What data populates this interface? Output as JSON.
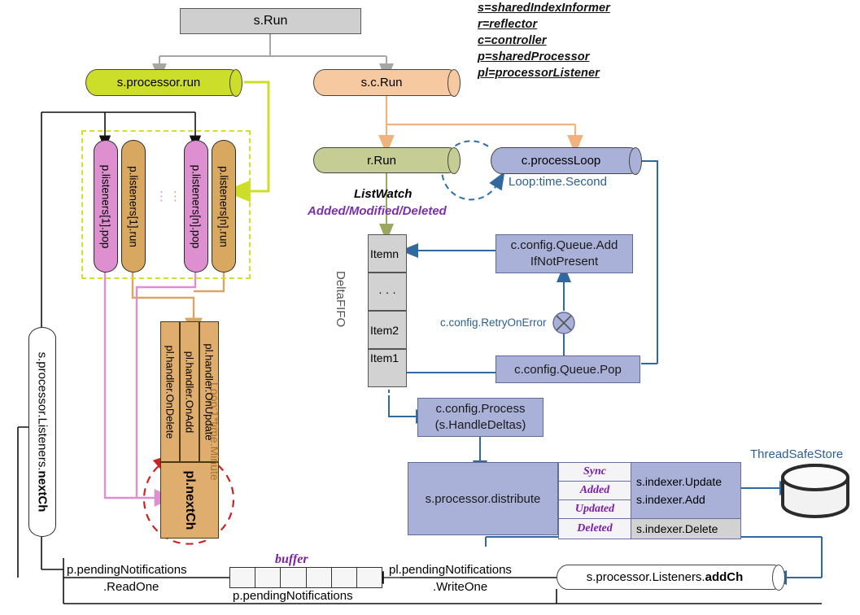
{
  "legend": [
    "s=sharedIndexInformer",
    "r=reflector",
    "c=controller",
    "p=sharedProcessor",
    "pl=processorListener"
  ],
  "nodes": {
    "s_run": "s.Run",
    "s_processor_run": "s.processor.run",
    "s_c_run": "s.c.Run",
    "r_run": "r.Run",
    "c_process_loop": "c.processLoop",
    "loop_second": "Loop:time.Second",
    "listwatch": "ListWatch",
    "added_modified_deleted": "Added/Modified/Deleted",
    "listener_pop_1": "p.listeners[1].pop",
    "listener_run_1": "p.listeners[1].run",
    "listener_pop_n": "p.listeners[n].pop",
    "listener_run_n": "p.listeners[n].run",
    "ellipsis": "⋮",
    "handler_on_update": "pl.handler.OnUpdate",
    "handler_on_add": "pl.handler.OnAdd",
    "handler_on_delete": "pl.handler.OnDelete",
    "pl_next_ch": "pl.nextCh",
    "loop_minute": "Loop:1*time.Minute",
    "processor_listeners_nextch_prefix": "s.processor.Listeners.",
    "processor_listeners_nextch_bold": "nextCh",
    "deltafifo": "DeltaFIFO",
    "fifo_item_n": "Itemn",
    "fifo_dots": "· · ·",
    "fifo_item_2": "Item2",
    "fifo_item_1": "Item1",
    "queue_add_if_not_present": "c.config.Queue.Add\nIfNotPresent",
    "queue_add_line1": "c.config.Queue.Add",
    "queue_add_line2": "IfNotPresent",
    "retry_on_error": "c.config.RetryOnError",
    "queue_pop": "c.config.Queue.Pop",
    "config_process_line1": "c.config.Process",
    "config_process_line2": "(s.HandleDeltas)",
    "processor_distribute": "s.processor.distribute",
    "thread_safe_store": "ThreadSafeStore",
    "buffer_label": "buffer",
    "buffer_name": "p.pendingNotifications",
    "pending_read_line1": "p.pendingNotifications",
    "pending_read_line2": ".ReadOne",
    "pending_write_line1": "pl.pendingNotifications",
    "pending_write_line2": ".WriteOne",
    "listeners_addch_prefix": "s.processor.Listeners.",
    "listeners_addch_bold": "addCh"
  },
  "distribute_table": {
    "events": [
      "Sync",
      "Added",
      "Updated",
      "Deleted"
    ],
    "actions": [
      "s.indexer.Update",
      "s.indexer.Add",
      "s.indexer.Delete"
    ]
  },
  "buffer_cells": 6,
  "colors": {
    "yellow_green": "#ccdd2a",
    "orange": "#f6c9a0",
    "olive": "#c5cd95",
    "blue": "#aab1d9",
    "pink": "#dd8fd0",
    "tan": "#d9a860",
    "gray": "#cfcfcf",
    "arrow_blue": "#31689e",
    "red_dash": "#cc2222",
    "purple_text": "#7b1fa2",
    "store_blue": "#4a7fb5"
  }
}
